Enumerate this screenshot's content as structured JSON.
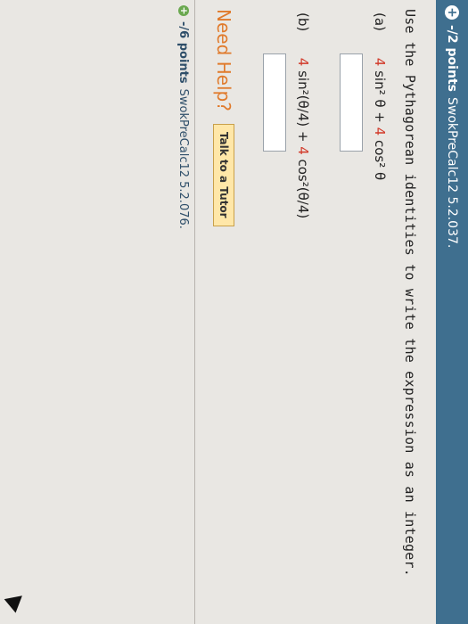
{
  "question": {
    "points": "-/2 points",
    "id": "SwokPreCalc12 5.2.037.",
    "prompt": "Use the Pythagorean identities to write the expression as an integer.",
    "parts": [
      {
        "label": "(a)",
        "coef1": "4",
        "mid": " sin² θ + ",
        "coef2": "4",
        "tail": " cos² θ"
      },
      {
        "label": "(b)",
        "coef1": "4",
        "mid": " sin²(θ/4) + ",
        "coef2": "4",
        "tail": " cos²(θ/4)"
      }
    ],
    "need_help": "Need Help?",
    "tutor_button": "Talk to a Tutor"
  },
  "next_question": {
    "points": "-/6 points",
    "id": "SwokPreCalc12 5.2.076."
  },
  "colors": {
    "header": "#3f6f8f",
    "coefficient": "#d23a2a",
    "need_help": "#e07a2b"
  }
}
